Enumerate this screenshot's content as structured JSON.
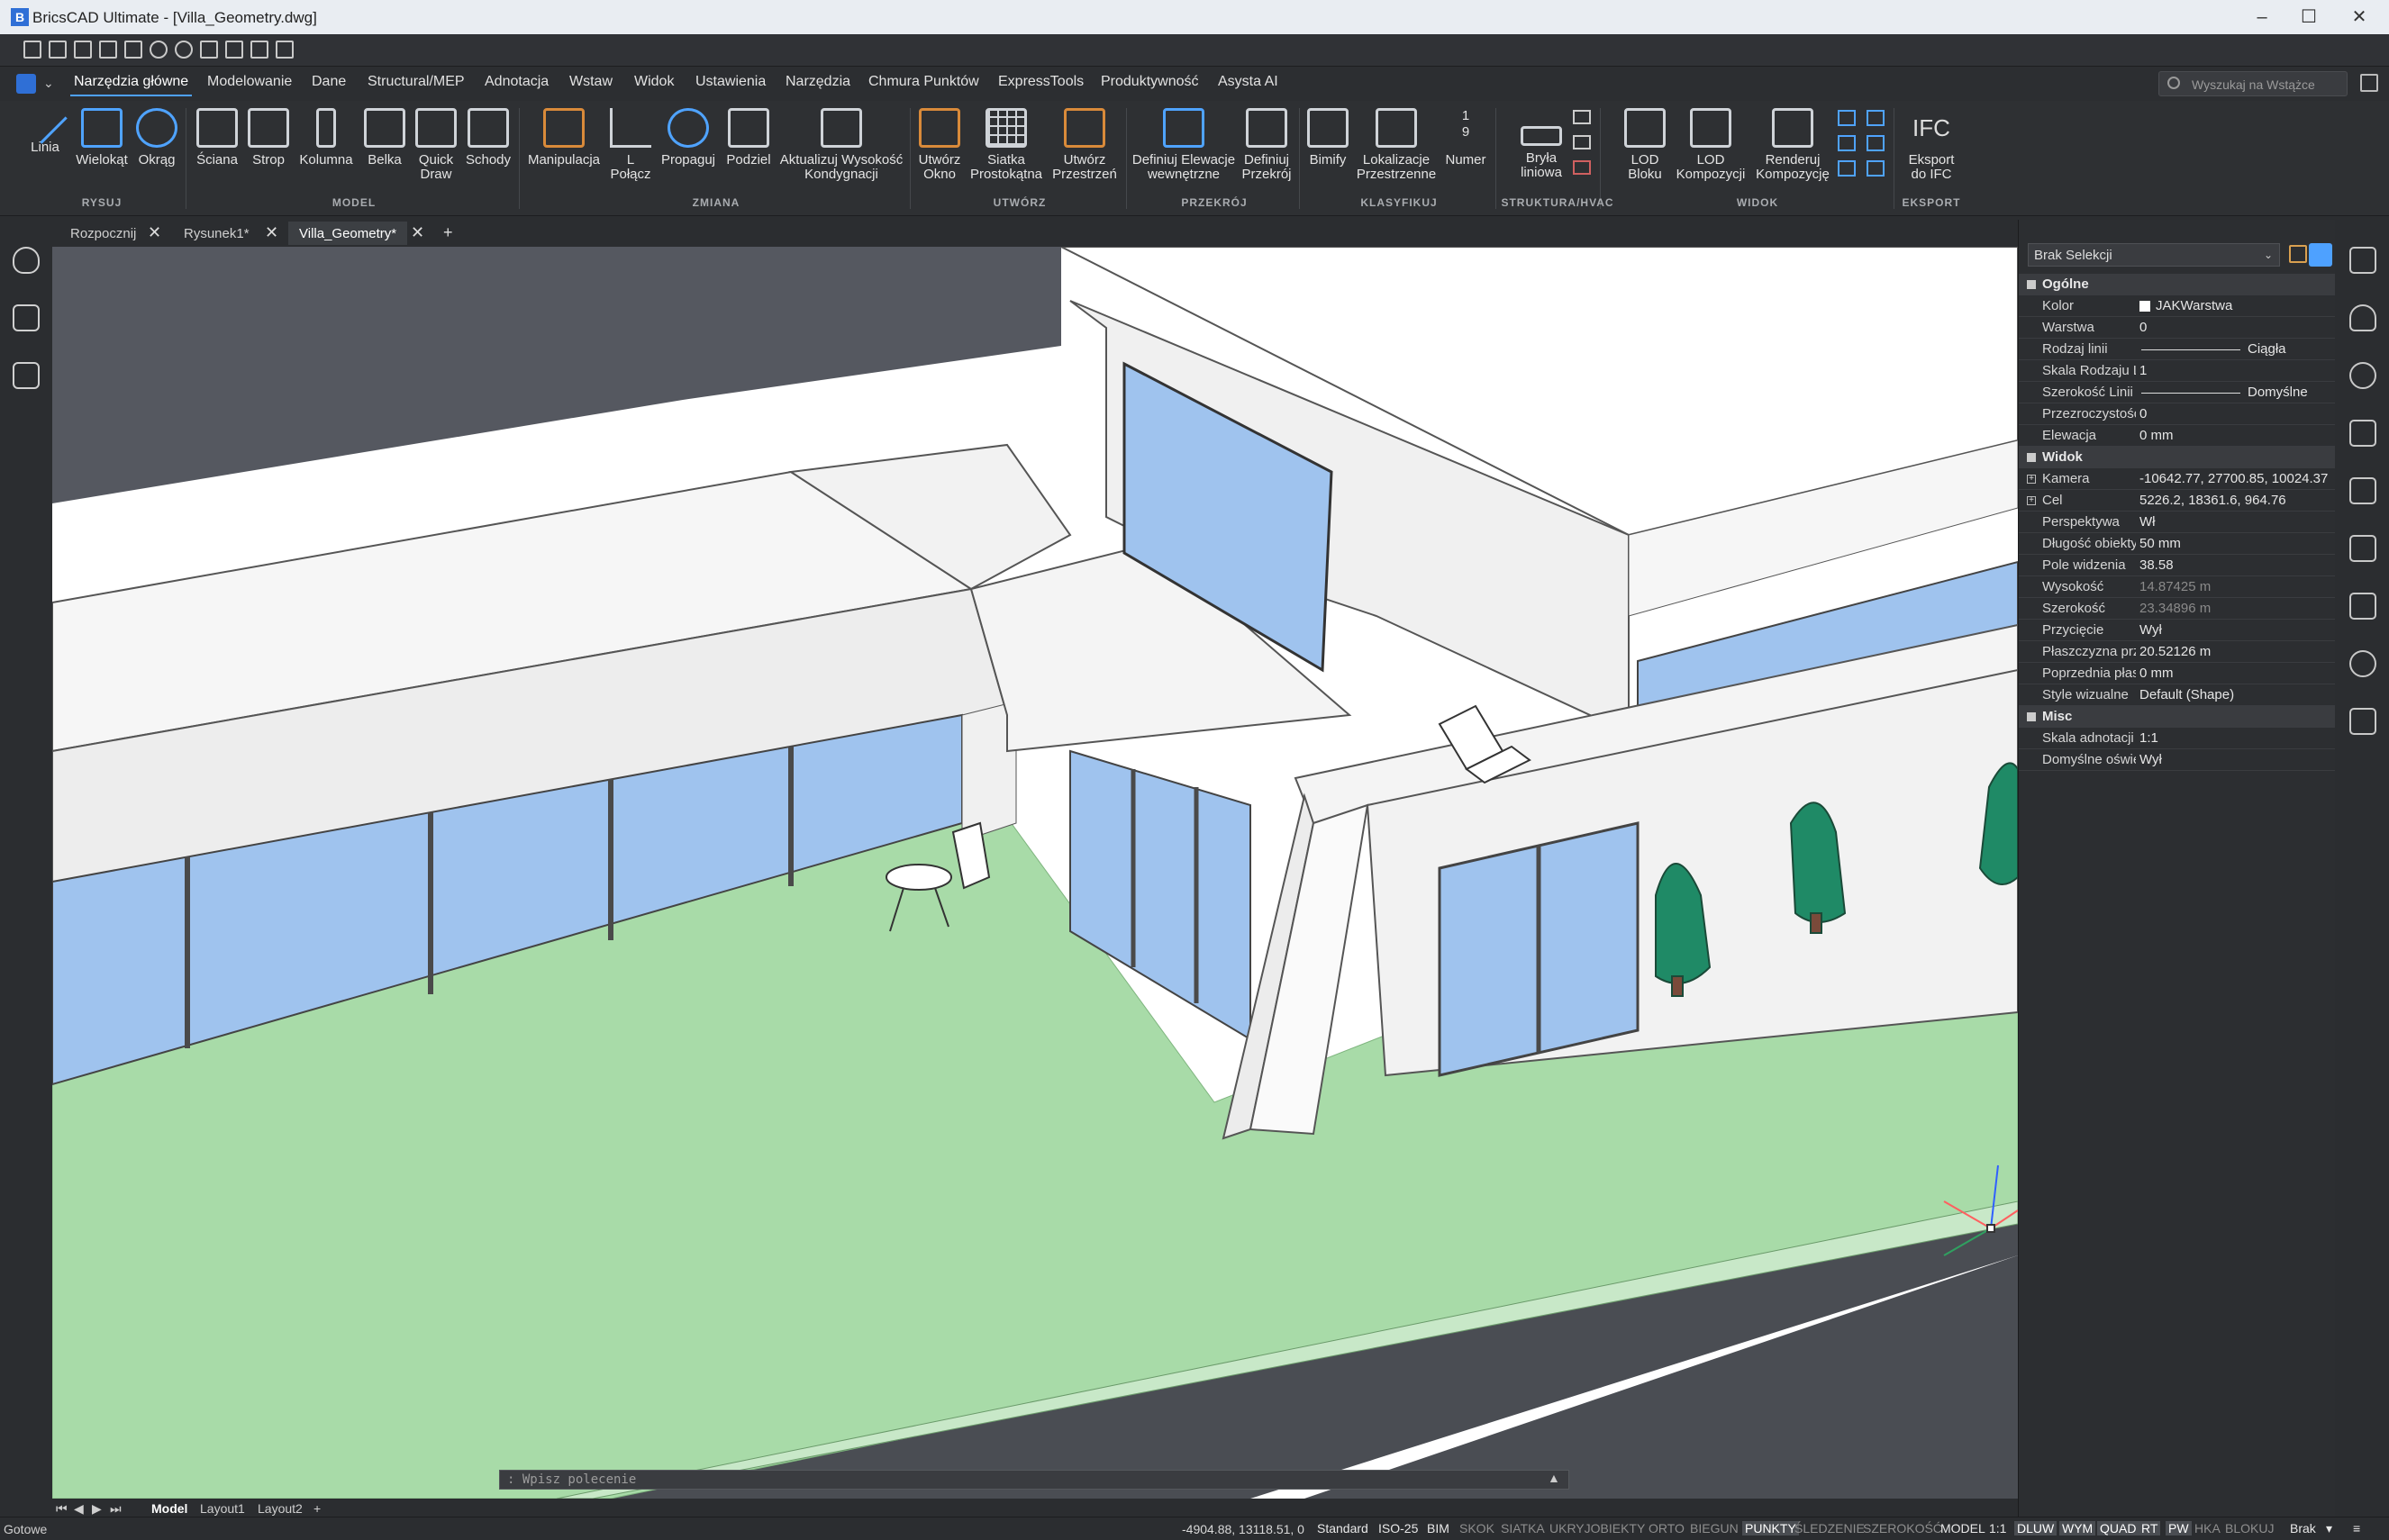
{
  "window": {
    "title": "BricsCAD Ultimate - [Villa_Geometry.dwg]",
    "app_icon_letter": "B"
  },
  "menu_tabs": [
    "Narzędzia główne",
    "Modelowanie",
    "Dane",
    "Structural/MEP",
    "Adnotacja",
    "Wstaw",
    "Widok",
    "Ustawienia",
    "Narzędzia",
    "Chmura Punktów",
    "ExpressTools",
    "Produktywność",
    "Asysta AI"
  ],
  "search": {
    "placeholder": "Wyszukaj na Wstążce"
  },
  "ribbon": {
    "buttons": [
      "Linia",
      "Wielokąt",
      "Okrąg",
      "Ściana",
      "Strop",
      "Kolumna",
      "Belka",
      "Quick\nDraw",
      "Schody",
      "Manipulacja",
      "L\nPołącz",
      "Propaguj",
      "Podziel",
      "Aktualizuj Wysokość\nKondygnacji",
      "Utwórz\nOkno",
      "Siatka\nProstokątna",
      "Utwórz\nPrzestrzeń",
      "Definiuj Elewacje\nwewnętrzne",
      "Definiuj\nPrzekrój",
      "Bimify",
      "Lokalizacje\nPrzestrzenne",
      "Numer",
      "Bryła\nliniowa",
      "LOD\nBloku",
      "LOD\nKompozycji",
      "Renderuj\nKompozycję",
      "Eksport\ndo IFC"
    ],
    "panels": [
      "RYSUJ",
      "MODEL",
      "ZMIANA",
      "UTWÓRZ",
      "PRZEKRÓJ",
      "KLASYFIKUJ",
      "STRUKTURA/HVAC",
      "WIDOK",
      "EKSPORT"
    ],
    "ifc_glyph": "IFC",
    "numer_glyph": "1\n9"
  },
  "doc_tabs": [
    "Rozpocznij",
    "Rysunek1*",
    "Villa_Geometry*"
  ],
  "doc_tab_add": "+",
  "command_line": {
    "placeholder": ": Wpisz polecenie"
  },
  "layout_tabs": [
    "Model",
    "Layout1",
    "Layout2"
  ],
  "properties": {
    "selection": "Brak Selekcji",
    "groups": [
      {
        "name": "Ogólne",
        "rows": [
          {
            "key": "Kolor",
            "value": "JAKWarstwa"
          },
          {
            "key": "Warstwa",
            "value": "0"
          },
          {
            "key": "Rodzaj linii",
            "value": "Ciągła"
          },
          {
            "key": "Skala Rodzaju Linii",
            "value": "1"
          },
          {
            "key": "Szerokość Linii",
            "value": "Domyślne"
          },
          {
            "key": "Przezroczystość",
            "value": "0"
          },
          {
            "key": "Elewacja",
            "value": "0 mm"
          }
        ]
      },
      {
        "name": "Widok",
        "rows": [
          {
            "key": "Kamera",
            "value": "-10642.77, 27700.85, 10024.37"
          },
          {
            "key": "Cel",
            "value": "5226.2, 18361.6, 964.76"
          },
          {
            "key": "Perspektywa",
            "value": "Wł"
          },
          {
            "key": "Długość obiektywu",
            "value": "50 mm"
          },
          {
            "key": "Pole widzenia",
            "value": "38.58"
          },
          {
            "key": "Wysokość",
            "value": "14.87425 m"
          },
          {
            "key": "Szerokość",
            "value": "23.34896 m"
          },
          {
            "key": "Przycięcie",
            "value": "Wył"
          },
          {
            "key": "Płaszczyzna przycięcia",
            "value": "20.52126 m"
          },
          {
            "key": "Poprzednia płaszczyzna",
            "value": "0 mm"
          },
          {
            "key": "Style wizualne",
            "value": "Default (Shape)"
          }
        ]
      },
      {
        "name": "Misc",
        "rows": [
          {
            "key": "Skala adnotacji",
            "value": "1:1"
          },
          {
            "key": "Domyślne oświetlenie",
            "value": "Wył"
          }
        ]
      }
    ]
  },
  "status": {
    "ready": "Gotowe",
    "coords": "-4904.88, 13118.51, 0",
    "items": [
      "Standard",
      "ISO-25",
      "BIM",
      "SKOK",
      "SIATKA",
      "UKRYJOBIEKTY",
      "ORTO",
      "BIEGUN",
      "PUNKTY",
      "ŚLEDZENIE",
      "SZEROKOŚĆ",
      "MODEL",
      "1:1",
      "DLUW",
      "WYM",
      "QUAD",
      "RT",
      "PW",
      "HKA",
      "BLOKUJ",
      "Brak"
    ]
  },
  "colors": {
    "accent": "#4ea1ff",
    "glass": "#9fc3ee",
    "lawn": "#a8dba8",
    "tree": "#1f8a66",
    "sky": "#ffffff",
    "ground": "#4a4d53"
  }
}
